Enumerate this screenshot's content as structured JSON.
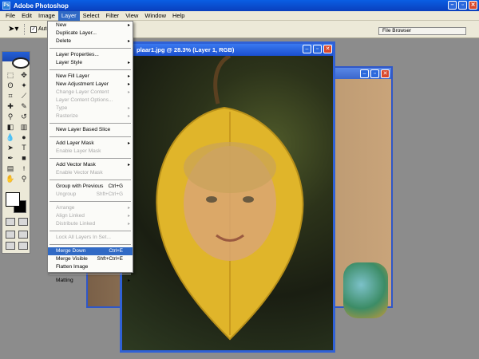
{
  "app": {
    "title": "Adobe Photoshop"
  },
  "menubar": [
    "File",
    "Edit",
    "Image",
    "Layer",
    "Select",
    "Filter",
    "View",
    "Window",
    "Help"
  ],
  "options": {
    "auto_label": "Auto",
    "file_browser": "File Browser"
  },
  "document": {
    "title": "plaar1.jpg @ 28.3% (Layer 1, RGB)"
  },
  "layer_menu": [
    {
      "label": "New",
      "arrow": true
    },
    {
      "label": "Duplicate Layer..."
    },
    {
      "label": "Delete",
      "arrow": true
    },
    {
      "sep": true
    },
    {
      "label": "Layer Properties..."
    },
    {
      "label": "Layer Style",
      "arrow": true
    },
    {
      "sep": true
    },
    {
      "label": "New Fill Layer",
      "arrow": true
    },
    {
      "label": "New Adjustment Layer",
      "arrow": true
    },
    {
      "label": "Change Layer Content",
      "arrow": true,
      "disabled": true
    },
    {
      "label": "Layer Content Options...",
      "disabled": true
    },
    {
      "label": "Type",
      "arrow": true,
      "disabled": true
    },
    {
      "label": "Rasterize",
      "arrow": true,
      "disabled": true
    },
    {
      "sep": true
    },
    {
      "label": "New Layer Based Slice"
    },
    {
      "sep": true
    },
    {
      "label": "Add Layer Mask",
      "arrow": true
    },
    {
      "label": "Enable Layer Mask",
      "disabled": true
    },
    {
      "sep": true
    },
    {
      "label": "Add Vector Mask",
      "arrow": true
    },
    {
      "label": "Enable Vector Mask",
      "disabled": true
    },
    {
      "sep": true
    },
    {
      "label": "Group with Previous",
      "shortcut": "Ctrl+G"
    },
    {
      "label": "Ungroup",
      "shortcut": "Shft+Ctrl+G",
      "disabled": true
    },
    {
      "sep": true
    },
    {
      "label": "Arrange",
      "arrow": true,
      "disabled": true
    },
    {
      "label": "Align Linked",
      "arrow": true,
      "disabled": true
    },
    {
      "label": "Distribute Linked",
      "arrow": true,
      "disabled": true
    },
    {
      "sep": true
    },
    {
      "label": "Lock All Layers In Set...",
      "disabled": true
    },
    {
      "sep": true
    },
    {
      "label": "Merge Down",
      "shortcut": "Ctrl+E",
      "highlighted": true
    },
    {
      "label": "Merge Visible",
      "shortcut": "Shft+Ctrl+E"
    },
    {
      "label": "Flatten Image"
    },
    {
      "sep": true
    },
    {
      "label": "Matting",
      "arrow": true
    }
  ],
  "colors": {
    "menu_highlight": "#316ac5",
    "title_bar": "#0a4fd0",
    "leaf": "#e0b52a"
  }
}
